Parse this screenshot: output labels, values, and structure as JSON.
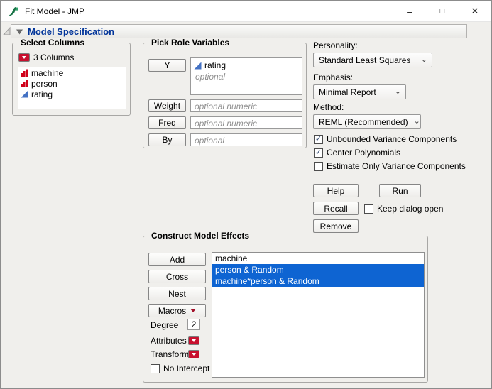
{
  "window": {
    "title": "Fit Model - JMP"
  },
  "icons": {
    "check": "✓",
    "chevron_down": "⌄",
    "minimize": "–",
    "maximize": "□",
    "close": "✕"
  },
  "model_spec": {
    "title": "Model Specification"
  },
  "select_columns": {
    "title": "Select Columns",
    "count_label": "3 Columns",
    "columns": [
      {
        "name": "machine",
        "type": "nominal"
      },
      {
        "name": "person",
        "type": "nominal"
      },
      {
        "name": "rating",
        "type": "continuous"
      }
    ]
  },
  "pick_roles": {
    "title": "Pick Role Variables",
    "y_label": "Y",
    "y_value": "rating",
    "y_optional": "optional",
    "weight_label": "Weight",
    "weight_placeholder": "optional numeric",
    "freq_label": "Freq",
    "freq_placeholder": "optional numeric",
    "by_label": "By",
    "by_placeholder": "optional"
  },
  "options": {
    "personality_label": "Personality:",
    "personality_value": "Standard Least Squares",
    "emphasis_label": "Emphasis:",
    "emphasis_value": "Minimal Report",
    "method_label": "Method:",
    "method_value": "REML (Recommended)",
    "checkboxes": [
      {
        "label": "Unbounded Variance Components",
        "checked": true
      },
      {
        "label": "Center Polynomials",
        "checked": true
      },
      {
        "label": "Estimate Only Variance Components",
        "checked": false
      }
    ]
  },
  "actions": {
    "help": "Help",
    "run": "Run",
    "recall": "Recall",
    "keep_dialog_open": "Keep dialog open",
    "remove": "Remove"
  },
  "effects": {
    "title": "Construct Model Effects",
    "add": "Add",
    "cross": "Cross",
    "nest": "Nest",
    "macros": "Macros",
    "degree_label": "Degree",
    "degree_value": "2",
    "attributes_label": "Attributes",
    "transform_label": "Transform",
    "no_intercept_label": "No Intercept",
    "items": [
      {
        "text": "machine",
        "selected": false
      },
      {
        "text": "person & Random",
        "selected": true
      },
      {
        "text": "machine*person & Random",
        "selected": true
      }
    ]
  }
}
